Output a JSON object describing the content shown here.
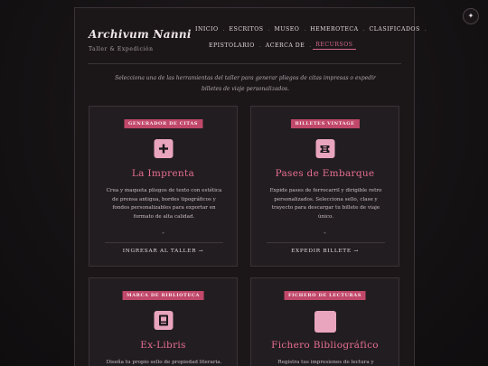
{
  "theme_toggle": {
    "glyph": "✦"
  },
  "header": {
    "logo_title": "Archivum Nanni",
    "logo_slash": "/",
    "logo_subtitle": "Taller & Expedición"
  },
  "nav": {
    "row1": [
      "INICIO",
      "ESCRITOS",
      "MUSEO",
      "HEMEROTECA",
      "CLASIFICADOS"
    ],
    "row2": [
      "EPISTOLARIO",
      "ACERCA DE",
      "RECURSOS"
    ],
    "active": "RECURSOS",
    "separator": "."
  },
  "intro": "Selecciona una de las herramientas del taller para generar pliegos de citas impresas o expedir billetes de viaje personalizados.",
  "cards": [
    {
      "badge": "GENERADOR DE CITAS",
      "icon": "plus-icon",
      "title": "La Imprenta",
      "desc": "Crea y maqueta pliegos de texto con estética de prensa antigua, bordes tipográficos y fondos personalizables para exportar en formato de alta calidad.",
      "star": "*",
      "action": "INGRESAR AL TALLER →"
    },
    {
      "badge": "BILLETES VINTAGE",
      "icon": "ticket-icon",
      "title": "Pases de Embarque",
      "desc": "Expide pases de ferrocarril y dirigible retro personalizados. Selecciona sello, clase y trayecto para descargar tu billete de viaje único.",
      "star": "*",
      "action": "EXPEDIR BILLETE →"
    },
    {
      "badge": "MARCA DE BIBLIOTECA",
      "icon": "book-icon",
      "title": "Ex-Libris",
      "desc": "Diseña tu propio sello de propiedad literaria."
    },
    {
      "badge": "FICHERO DE LECTURAS",
      "icon": "card-file-icon",
      "title": "Fichero Bibliográfico",
      "desc": "Registra tus impresiones de lectura y cataloga"
    }
  ],
  "colors": {
    "accent": "#e76e93",
    "badge": "#c0486a",
    "icon_bg": "#e9a5bd",
    "bg": "#151214"
  }
}
